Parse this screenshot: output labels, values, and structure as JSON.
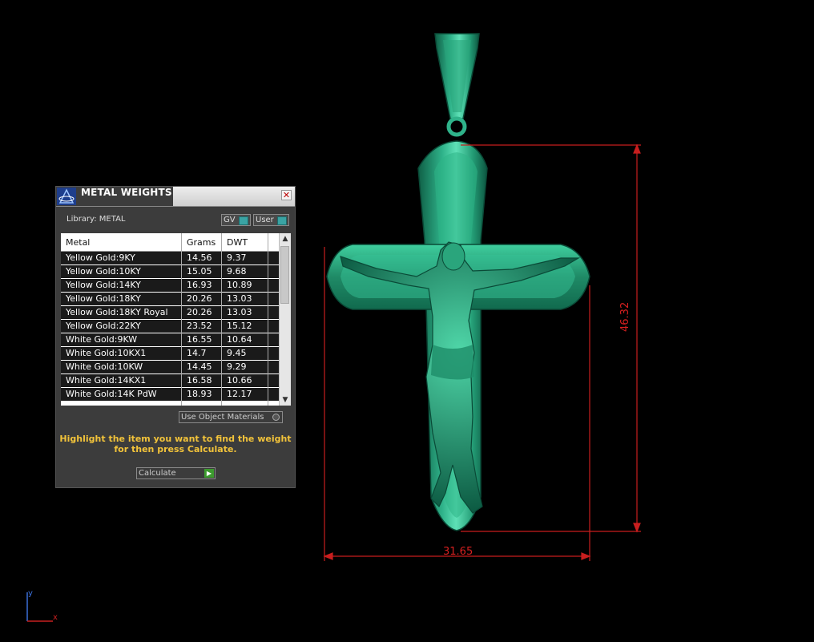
{
  "panel": {
    "title": "METAL WEIGHTS",
    "close": "✕",
    "library": "Library: METAL",
    "gv_label": "GV",
    "user_label": "User",
    "columns": [
      "Metal",
      "Grams",
      "DWT"
    ],
    "rows": [
      {
        "metal": "Yellow Gold:9KY",
        "grams": "14.56",
        "dwt": "9.37"
      },
      {
        "metal": "Yellow Gold:10KY",
        "grams": "15.05",
        "dwt": "9.68"
      },
      {
        "metal": "Yellow Gold:14KY",
        "grams": "16.93",
        "dwt": "10.89"
      },
      {
        "metal": "Yellow Gold:18KY",
        "grams": "20.26",
        "dwt": "13.03"
      },
      {
        "metal": "Yellow Gold:18KY Royal",
        "grams": "20.26",
        "dwt": "13.03"
      },
      {
        "metal": "Yellow Gold:22KY",
        "grams": "23.52",
        "dwt": "15.12"
      },
      {
        "metal": "White Gold:9KW",
        "grams": "16.55",
        "dwt": "10.64"
      },
      {
        "metal": "White Gold:10KX1",
        "grams": "14.7",
        "dwt": "9.45"
      },
      {
        "metal": "White Gold:10KW",
        "grams": "14.45",
        "dwt": "9.29"
      },
      {
        "metal": "White Gold:14KX1",
        "grams": "16.58",
        "dwt": "10.66"
      },
      {
        "metal": "White Gold:14K PdW",
        "grams": "18.93",
        "dwt": "12.17"
      }
    ],
    "use_object_materials": "Use Object Materials",
    "hint_line1": "Highlight the item you want to find the weight",
    "hint_line2": "for then press Calculate.",
    "calculate": "Calculate"
  },
  "dimensions": {
    "width": "31.65",
    "height": "46.32"
  },
  "axis": {
    "y": "y",
    "x": "x"
  },
  "colors": {
    "model": "#1f8a66",
    "dimension": "#d82020",
    "hint": "#f2c33a"
  }
}
